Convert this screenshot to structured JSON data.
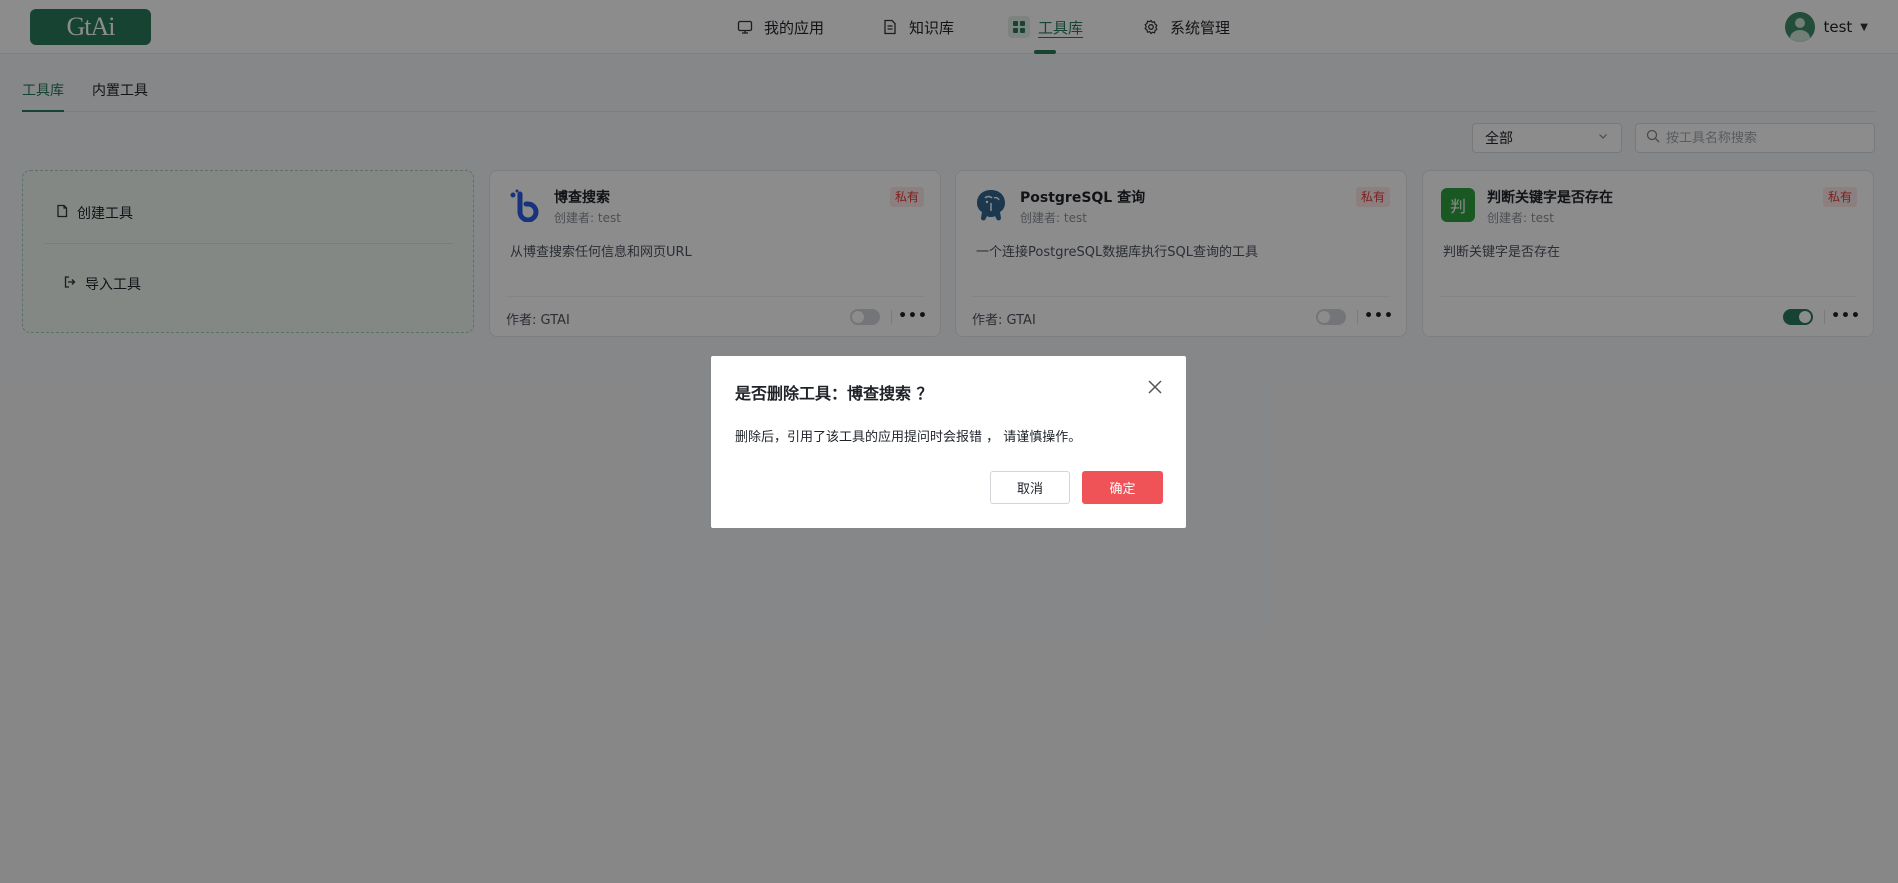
{
  "header": {
    "logo_text": "GtAi",
    "nav": [
      {
        "label": "我的应用",
        "icon": "monitor-icon"
      },
      {
        "label": "知识库",
        "icon": "document-icon"
      },
      {
        "label": "工具库",
        "icon": "grid-icon",
        "active": true
      },
      {
        "label": "系统管理",
        "icon": "gear-icon"
      }
    ],
    "user": {
      "name": "test"
    }
  },
  "tabs": [
    {
      "label": "工具库",
      "active": true
    },
    {
      "label": "内置工具"
    }
  ],
  "toolbar": {
    "filter_value": "全部",
    "search_placeholder": "按工具名称搜索"
  },
  "create_panel": {
    "create_label": "创建工具",
    "import_label": "导入工具"
  },
  "tools": [
    {
      "title": "博查搜索",
      "creator": "创建者: test",
      "badge": "私有",
      "desc": "从博查搜索任何信息和网页URL",
      "author": "作者: GTAI",
      "enabled": false,
      "icon": "bocha-logo-icon"
    },
    {
      "title": "PostgreSQL 查询",
      "creator": "创建者: test",
      "badge": "私有",
      "desc": "一个连接PostgreSQL数据库执行SQL查询的工具",
      "author": "作者: GTAI",
      "enabled": false,
      "icon": "postgresql-elephant-icon"
    },
    {
      "title": "判断关键字是否存在",
      "creator": "创建者: test",
      "badge": "私有",
      "desc": "判断关键字是否存在",
      "author": "",
      "enabled": true,
      "icon": "judge-char-icon",
      "icon_char": "判"
    }
  ],
  "dialog": {
    "title": "是否删除工具：博查搜索 ？",
    "body": "删除后，引用了该工具的应用提问时会报错 ， 请谨慎操作。",
    "cancel_label": "取消",
    "confirm_label": "确定"
  },
  "colors": {
    "brand": "#2b7a5b",
    "danger": "#f05357",
    "badge_bg": "#fde8e8"
  }
}
